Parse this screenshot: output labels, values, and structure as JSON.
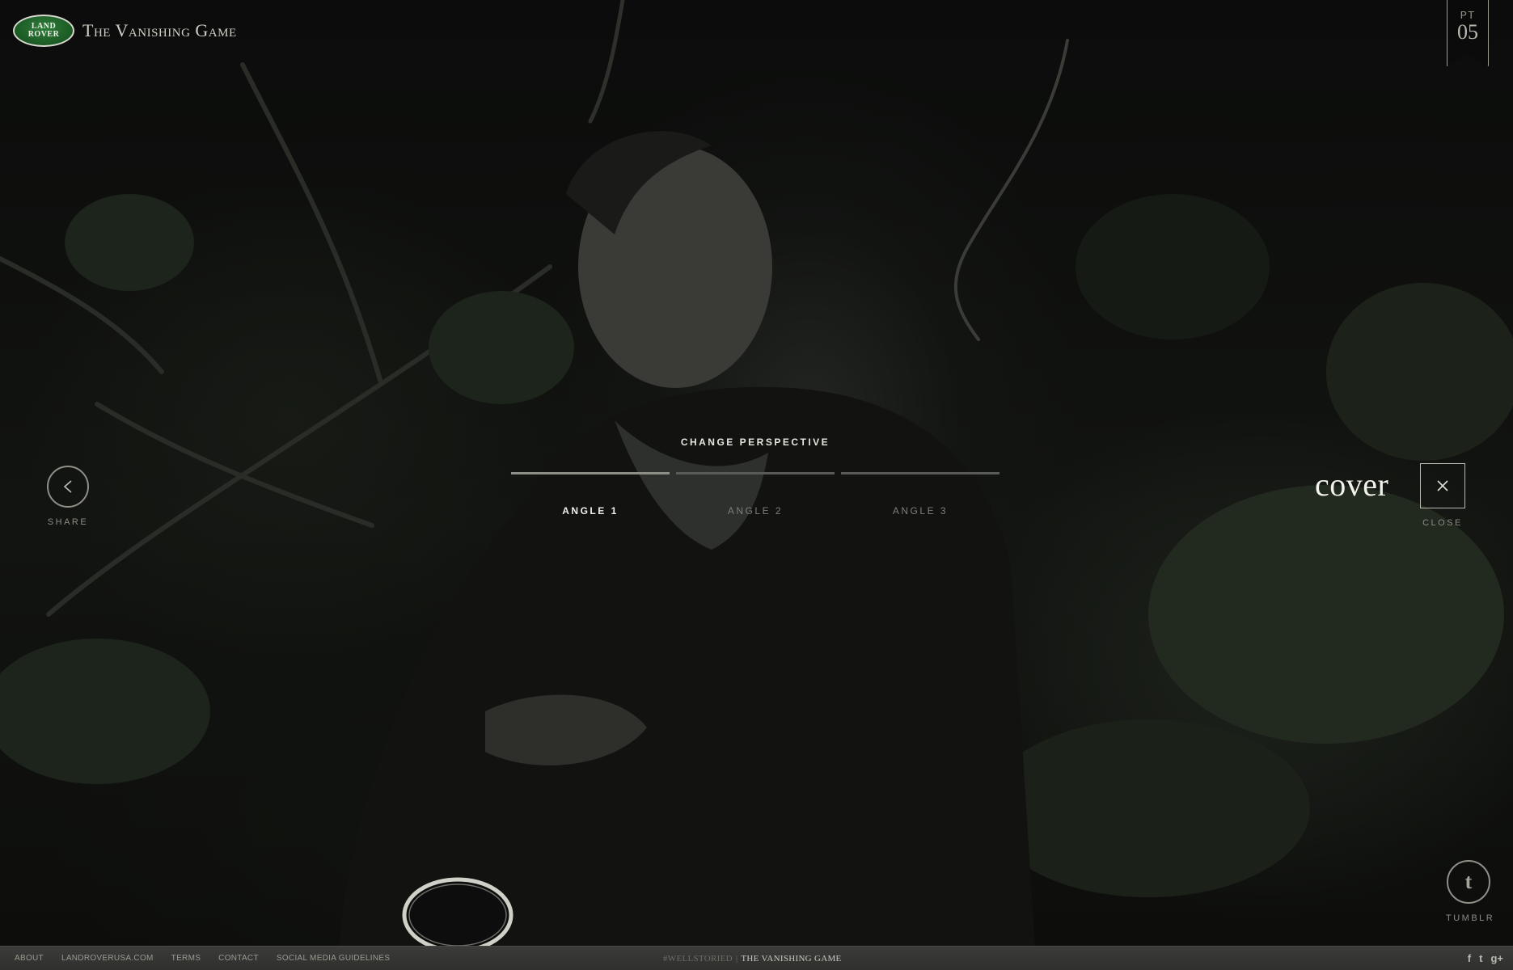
{
  "header": {
    "logo_line1": "LAND",
    "logo_line2": "ROVER",
    "site_title": "The Vanishing Game",
    "page_tag_prefix": "PT",
    "page_tag_number": "05"
  },
  "share": {
    "label": "SHARE",
    "icon": "share-icon"
  },
  "perspective": {
    "title": "CHANGE PERSPECTIVE",
    "angles": [
      {
        "label": "ANGLE 1",
        "active": true
      },
      {
        "label": "ANGLE 2",
        "active": false
      },
      {
        "label": "ANGLE 3",
        "active": false
      }
    ]
  },
  "cover": {
    "word": "cover",
    "close_label": "CLOSE",
    "close_icon": "close-icon"
  },
  "tumblr": {
    "glyph": "t",
    "label": "TUMBLR",
    "icon": "tumblr-icon"
  },
  "footer": {
    "links": [
      "ABOUT",
      "LANDROVERUSA.COM",
      "TERMS",
      "CONTACT",
      "SOCIAL MEDIA GUIDELINES"
    ],
    "hashtag": "#WELLSTORIED",
    "separator": "|",
    "game_title": "THE VANISHING GAME",
    "social": [
      "f",
      "t",
      "g+"
    ]
  },
  "colors": {
    "background": "#0a0b0a",
    "logo_green": "#1b5a25",
    "footer_bar": "#353633",
    "text_light": "#efefe8"
  }
}
